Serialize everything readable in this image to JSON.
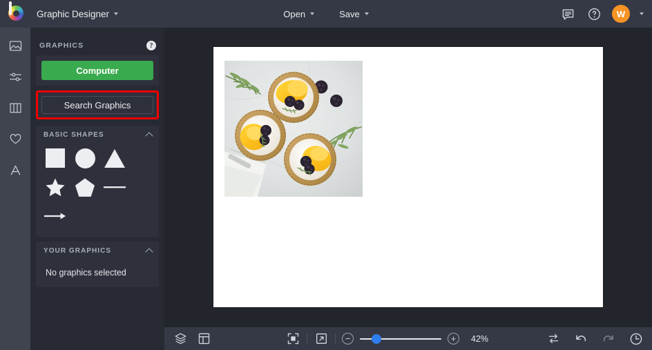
{
  "header": {
    "logo_name": "brand-logo",
    "app_title": "Graphic Designer",
    "open_label": "Open",
    "save_label": "Save",
    "comments_icon": "comment-icon",
    "help_icon": "help-circle-icon",
    "avatar_initial": "W",
    "avatar_color": "#f59324"
  },
  "rail": {
    "items": [
      {
        "name": "image-tool",
        "icon": "image-icon"
      },
      {
        "name": "adjust-tool",
        "icon": "sliders-icon"
      },
      {
        "name": "layout-tool",
        "icon": "columns-icon"
      },
      {
        "name": "favorites-tool",
        "icon": "heart-icon"
      },
      {
        "name": "text-tool",
        "icon": "text-a-icon"
      }
    ]
  },
  "panel": {
    "title": "GRAPHICS",
    "help_icon": "question-mark-icon",
    "computer_button": "Computer",
    "computer_button_color": "#3aaa4e",
    "search_button": "Search Graphics",
    "search_highlight_color": "#f00000",
    "sections": [
      {
        "title": "BASIC SHAPES",
        "collapse_icon": "chevron-up-icon",
        "shapes": [
          "square-shape",
          "circle-shape",
          "triangle-shape",
          "star-shape",
          "pentagon-shape",
          "line-shape",
          "arrow-shape"
        ]
      },
      {
        "title": "YOUR GRAPHICS",
        "collapse_icon": "chevron-up-icon",
        "empty_text": "No graphics selected"
      }
    ]
  },
  "canvas": {
    "name": "design-canvas",
    "background": "#ffffff",
    "photo_alt": "Tarts with orange slices and blackberries on marble"
  },
  "bottombar": {
    "layers_icon": "layers-icon",
    "grid_icon": "panel-layout-icon",
    "fit_icon": "fit-to-screen-icon",
    "expand_icon": "expand-arrow-icon",
    "zoom_out_label": "−",
    "zoom_in_label": "+",
    "zoom_value": "42%",
    "slider_percent": 14,
    "compare_icon": "compare-swap-icon",
    "undo_icon": "undo-arrow-icon",
    "redo_icon": "redo-arrow-icon",
    "history_icon": "history-clock-icon"
  }
}
